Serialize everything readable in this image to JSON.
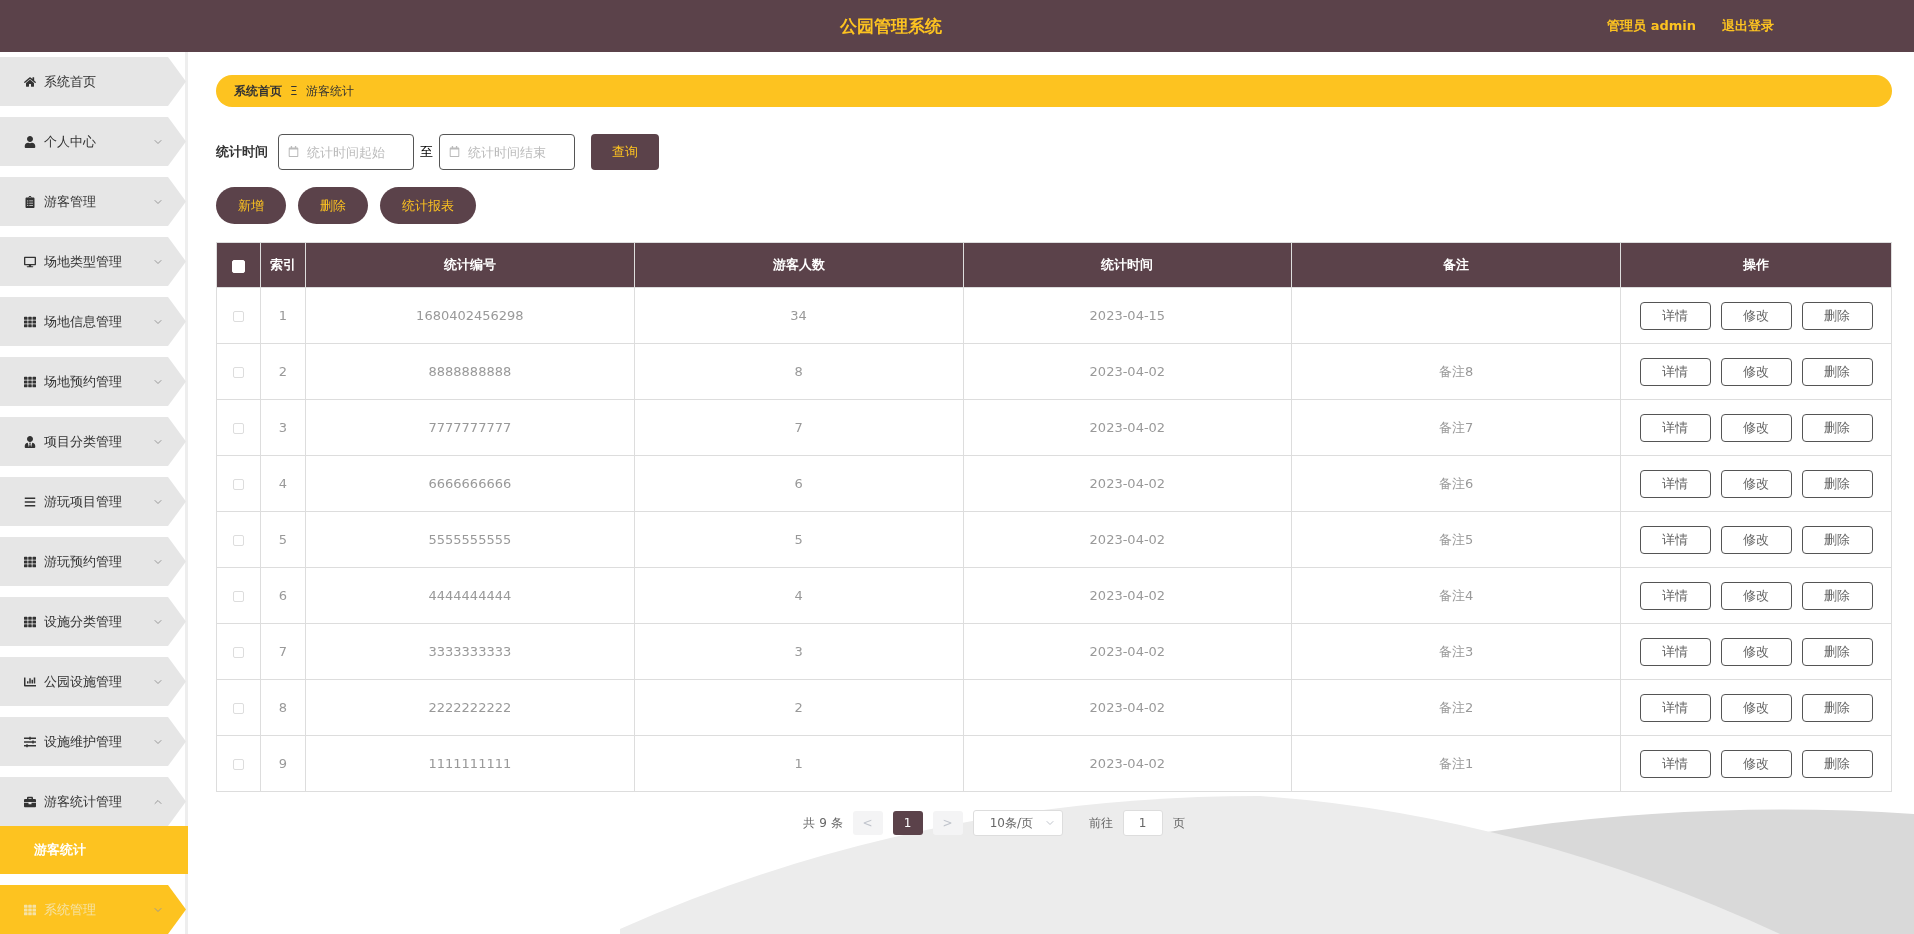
{
  "header": {
    "title": "公园管理系统",
    "user": "管理员 admin",
    "logout": "退出登录"
  },
  "sidebar": {
    "items": [
      {
        "label": "系统首页",
        "highlighted": false
      },
      {
        "label": "个人中心",
        "highlighted": false,
        "expanded": false
      },
      {
        "label": "游客管理",
        "highlighted": false,
        "expanded": false
      },
      {
        "label": "场地类型管理",
        "highlighted": false,
        "expanded": false
      },
      {
        "label": "场地信息管理",
        "highlighted": false,
        "expanded": false
      },
      {
        "label": "场地预约管理",
        "highlighted": false,
        "expanded": false
      },
      {
        "label": "项目分类管理",
        "highlighted": false,
        "expanded": false
      },
      {
        "label": "游玩项目管理",
        "highlighted": false,
        "expanded": false
      },
      {
        "label": "游玩预约管理",
        "highlighted": false,
        "expanded": false
      },
      {
        "label": "设施分类管理",
        "highlighted": false,
        "expanded": false
      },
      {
        "label": "公园设施管理",
        "highlighted": false,
        "expanded": false
      },
      {
        "label": "设施维护管理",
        "highlighted": false,
        "expanded": false
      },
      {
        "label": "游客统计管理",
        "highlighted": false,
        "expanded": true,
        "children": [
          {
            "label": "游客统计",
            "selected": true
          }
        ]
      },
      {
        "label": "系统管理",
        "highlighted": true,
        "expanded": false
      }
    ]
  },
  "breadcrumb": {
    "home": "系统首页",
    "separator": "Ξ",
    "current": "游客统计"
  },
  "filter": {
    "label": "统计时间",
    "start_placeholder": "统计时间起始",
    "to": "至",
    "end_placeholder": "统计时间结束",
    "search": "查询"
  },
  "actions": [
    "新增",
    "删除",
    "统计报表"
  ],
  "table": {
    "select_all_checked": false,
    "columns": [
      "索引",
      "统计编号",
      "游客人数",
      "统计时间",
      "备注",
      "操作"
    ],
    "rows": [
      {
        "checked": false,
        "index": "1",
        "code": "1680402456298",
        "count": "34",
        "date": "2023-04-15",
        "remark": "",
        "actions": [
          "详情",
          "修改",
          "删除"
        ]
      },
      {
        "checked": false,
        "index": "2",
        "code": "8888888888",
        "count": "8",
        "date": "2023-04-02",
        "remark": "备注8",
        "actions": [
          "详情",
          "修改",
          "删除"
        ]
      },
      {
        "checked": false,
        "index": "3",
        "code": "7777777777",
        "count": "7",
        "date": "2023-04-02",
        "remark": "备注7",
        "actions": [
          "详情",
          "修改",
          "删除"
        ]
      },
      {
        "checked": false,
        "index": "4",
        "code": "6666666666",
        "count": "6",
        "date": "2023-04-02",
        "remark": "备注6",
        "actions": [
          "详情",
          "修改",
          "删除"
        ]
      },
      {
        "checked": false,
        "index": "5",
        "code": "5555555555",
        "count": "5",
        "date": "2023-04-02",
        "remark": "备注5",
        "actions": [
          "详情",
          "修改",
          "删除"
        ]
      },
      {
        "checked": false,
        "index": "6",
        "code": "4444444444",
        "count": "4",
        "date": "2023-04-02",
        "remark": "备注4",
        "actions": [
          "详情",
          "修改",
          "删除"
        ]
      },
      {
        "checked": false,
        "index": "7",
        "code": "3333333333",
        "count": "3",
        "date": "2023-04-02",
        "remark": "备注3",
        "actions": [
          "详情",
          "修改",
          "删除"
        ]
      },
      {
        "checked": false,
        "index": "8",
        "code": "2222222222",
        "count": "2",
        "date": "2023-04-02",
        "remark": "备注2",
        "actions": [
          "详情",
          "修改",
          "删除"
        ]
      },
      {
        "checked": false,
        "index": "9",
        "code": "1111111111",
        "count": "1",
        "date": "2023-04-02",
        "remark": "备注1",
        "actions": [
          "详情",
          "修改",
          "删除"
        ]
      }
    ]
  },
  "pagination": {
    "total": "共 9 条",
    "prev": "<",
    "pages": [
      {
        "label": "1",
        "selected": true
      }
    ],
    "next": ">",
    "page_size": "10条/页",
    "goto": "前往",
    "goto_value": "1",
    "page_unit": "页"
  }
}
